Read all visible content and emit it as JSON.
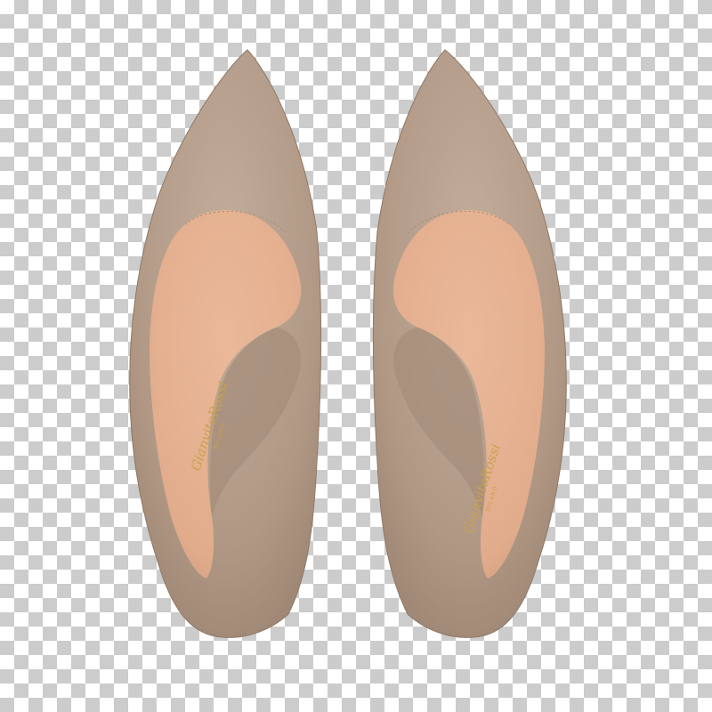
{
  "image": {
    "subject": "pair of suede pointed-toe pumps viewed from above",
    "background": "transparent-checkerboard"
  },
  "colors": {
    "suede": "#b19a87",
    "suede_shadow": "#9c8472",
    "suede_highlight": "#c4b0a0",
    "insole": "#e6b394",
    "insole_shadow": "#d29f80",
    "logo_gold": "#c9a24a"
  },
  "logo": {
    "brand": "GianvitoRossi",
    "city": "MILANO"
  }
}
